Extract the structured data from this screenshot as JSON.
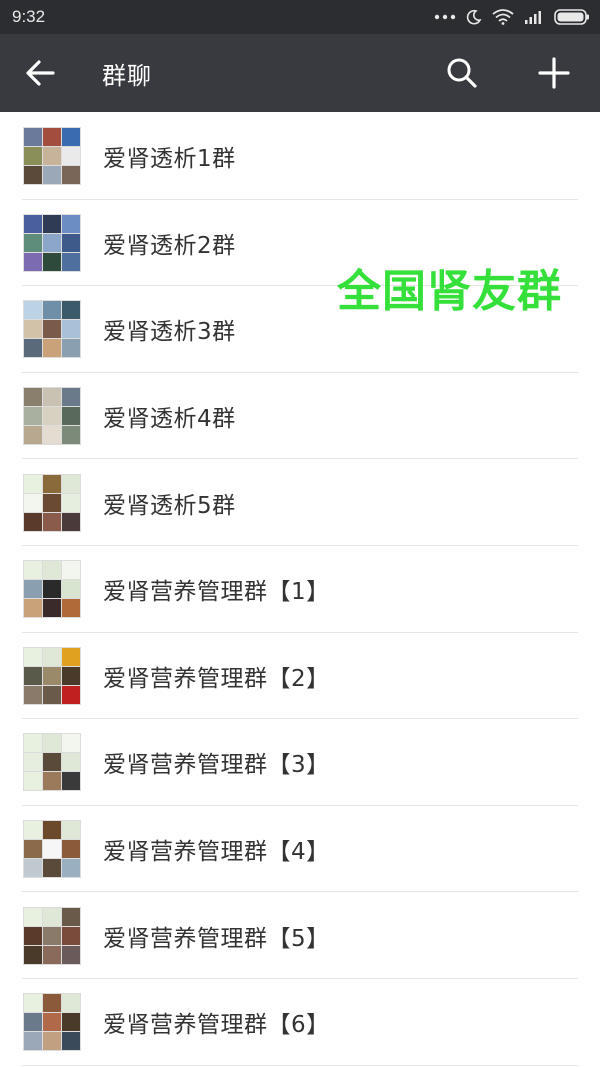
{
  "status_bar": {
    "time": "9:32",
    "icons": [
      "dots-icon",
      "moon-icon",
      "wifi-icon",
      "signal-icon",
      "battery-icon"
    ]
  },
  "nav": {
    "title": "群聊",
    "back_icon": "back-arrow-icon",
    "search_icon": "search-icon",
    "add_icon": "plus-icon"
  },
  "groups": [
    {
      "name": "爱肾透析1群"
    },
    {
      "name": "爱肾透析2群"
    },
    {
      "name": "爱肾透析3群"
    },
    {
      "name": "爱肾透析4群"
    },
    {
      "name": "爱肾透析5群"
    },
    {
      "name": "爱肾营养管理群【1】"
    },
    {
      "name": "爱肾营养管理群【2】"
    },
    {
      "name": "爱肾营养管理群【3】"
    },
    {
      "name": "爱肾营养管理群【4】"
    },
    {
      "name": "爱肾营养管理群【5】"
    },
    {
      "name": "爱肾营养管理群【6】"
    }
  ],
  "watermark": "全国肾友群",
  "colors": {
    "status_bar_bg": "#2b2d31",
    "nav_bg": "#393a3f",
    "watermark": "#35e03a",
    "text": "#333333"
  }
}
